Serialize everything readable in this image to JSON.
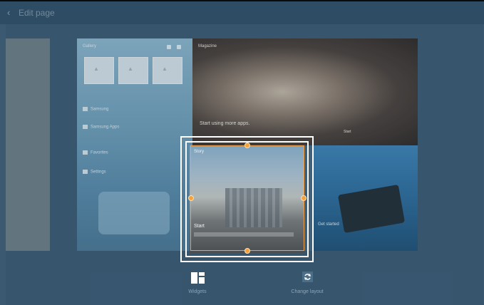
{
  "header": {
    "title": "Edit page",
    "back_icon": "back-arrow-icon"
  },
  "sidepanel": {
    "header_label": "Gallery",
    "list": [
      "Samsung",
      "Samsung Apps",
      "Favorites",
      "Settings"
    ]
  },
  "tiles": {
    "book_label": "Magazine",
    "book_text": "Start using more apps.",
    "book_button": "Start",
    "tablet_text": "Get started"
  },
  "widget": {
    "header_label": "Story",
    "caption": "Start"
  },
  "toolbar": {
    "widgets_label": "Widgets",
    "change_layout_label": "Change layout",
    "widgets_icon": "widgets-icon",
    "change_layout_icon": "refresh-icon"
  },
  "colors": {
    "accent": "#f4a23c",
    "selection": "#ffffff",
    "background": "#3b5a72"
  }
}
